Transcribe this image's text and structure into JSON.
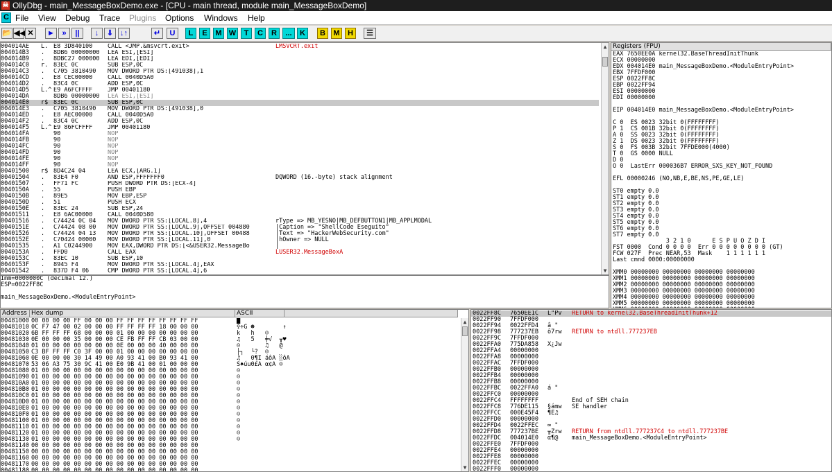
{
  "window": {
    "title": "OllyDbg - main_MessageBoxDemo.exe - [CPU - main thread, module main_MessageBoxDemo]",
    "icon": "ollydbg-app-icon"
  },
  "menu": {
    "c_icon": "C",
    "items": [
      {
        "label": "File",
        "disabled": false
      },
      {
        "label": "View",
        "disabled": false
      },
      {
        "label": "Debug",
        "disabled": false
      },
      {
        "label": "Trace",
        "disabled": false
      },
      {
        "label": "Plugins",
        "disabled": true
      },
      {
        "label": "Options",
        "disabled": false
      },
      {
        "label": "Windows",
        "disabled": false
      },
      {
        "label": "Help",
        "disabled": false
      }
    ]
  },
  "toolbar": {
    "ctrl_buttons": [
      "►",
      "»",
      "||",
      "↓",
      "⇓",
      "↓↑",
      "↵",
      "U"
    ],
    "letter_buttons": [
      "L",
      "E",
      "M",
      "W",
      "T",
      "C",
      "R",
      "...",
      "K"
    ],
    "yellow_buttons": [
      "B",
      "M",
      "H"
    ]
  },
  "disasm": {
    "rows": [
      [
        "004014AE",
        "L.",
        "E8 3D840100",
        "CALL <JMP.&msvcrt.exit>",
        "LMSVCRT.exit",
        "red"
      ],
      [
        "004014B3",
        ".",
        "8DB6 00000000",
        "LEA ESI,[ESI]",
        "",
        ""
      ],
      [
        "004014B9",
        ".",
        "8DBC27 000000",
        "LEA EDI,[EDI]",
        "",
        ""
      ],
      [
        "004014C0",
        "r.",
        "83EC 0C",
        "SUB ESP,0C",
        "",
        ""
      ],
      [
        "004014C3",
        ".",
        "C705 3810490",
        "MOV DWORD PTR DS:[491038],1",
        "",
        ""
      ],
      [
        "004014CD",
        ".",
        "E8 CEC00000",
        "CALL 0040D5A0",
        "",
        ""
      ],
      [
        "004014D2",
        ".",
        "83C4 0C",
        "ADD ESP,0C",
        "",
        ""
      ],
      [
        "004014D5",
        "L.^",
        "E9 A6FCFFFF",
        "JMP 00401180",
        "",
        ""
      ],
      [
        "004014DA",
        "",
        "8DB6 00000000",
        "LEA ESI,[ESI]",
        "",
        "gray"
      ],
      [
        "004014E0",
        "r$",
        "83EC 0C",
        "SUB ESP,0C",
        "",
        "sel"
      ],
      [
        "004014E3",
        ".",
        "C705 3810490",
        "MOV DWORD PTR DS:[491038],0",
        "",
        ""
      ],
      [
        "004014ED",
        ".",
        "E8 AEC00000",
        "CALL 0040D5A0",
        "",
        ""
      ],
      [
        "004014F2",
        ".",
        "83C4 0C",
        "ADD ESP,0C",
        "",
        ""
      ],
      [
        "004014F5",
        "L.^",
        "E9 86FCFFFF",
        "JMP 00401180",
        "",
        ""
      ],
      [
        "004014FA",
        "",
        "90",
        "NOP",
        "",
        "gray"
      ],
      [
        "004014FB",
        "",
        "90",
        "NOP",
        "",
        "gray"
      ],
      [
        "004014FC",
        "",
        "90",
        "NOP",
        "",
        "gray"
      ],
      [
        "004014FD",
        "",
        "90",
        "NOP",
        "",
        "gray"
      ],
      [
        "004014FE",
        "",
        "90",
        "NOP",
        "",
        "gray"
      ],
      [
        "004014FF",
        "",
        "90",
        "NOP",
        "",
        "gray"
      ],
      [
        "00401500",
        "r$",
        "8D4C24 04",
        "LEA ECX,[ARG.1]",
        "",
        ""
      ],
      [
        "00401504",
        ".",
        "83E4 F0",
        "AND ESP,FFFFFFF0",
        "DQWORD (16.-byte) stack alignment",
        ""
      ],
      [
        "00401507",
        ".",
        "FF71 FC",
        "PUSH DWORD PTR DS:[ECX-4]",
        "",
        ""
      ],
      [
        "0040150A",
        ".",
        "55",
        "PUSH EBP",
        "",
        ""
      ],
      [
        "0040150B",
        ".",
        "89E5",
        "MOV EBP,ESP",
        "",
        ""
      ],
      [
        "0040150D",
        ".",
        "51",
        "PUSH ECX",
        "",
        ""
      ],
      [
        "0040150E",
        ".",
        "83EC 24",
        "SUB ESP,24",
        "",
        ""
      ],
      [
        "00401511",
        ".",
        "E8 6AC00000",
        "CALL 0040D580",
        "",
        ""
      ],
      [
        "00401516",
        ".",
        "C74424 0C 04",
        "MOV DWORD PTR SS:[LOCAL.8],4",
        "rType => MB_YESNO|MB_DEFBUTTON1|MB_APPLMODAL",
        ""
      ],
      [
        "0040151E",
        ".",
        "C74424 08 00",
        "MOV DWORD PTR SS:[LOCAL.9],OFFSET 004880",
        "|Caption => \"ShellCode Eseguito\"",
        ""
      ],
      [
        "00401526",
        ".",
        "C74424 04 13",
        "MOV DWORD PTR SS:[LOCAL.10],OFFSET 00488",
        "|Text => \"HackerWebSecurity.com\"",
        ""
      ],
      [
        "0040152E",
        ".",
        "C70424 00000",
        "MOV DWORD PTR SS:[LOCAL.11],0",
        "|hOwner => NULL",
        ""
      ],
      [
        "00401535",
        ".",
        "A1 C0244900",
        "MOV EAX,DWORD PTR DS:[<&USER32.MessageBo",
        "|",
        ""
      ],
      [
        "0040153A",
        ".",
        "FFD0",
        "CALL EAX",
        "LUSER32.MessageBoxA",
        "red"
      ],
      [
        "0040153C",
        ".",
        "83EC 10",
        "SUB ESP,10",
        "",
        ""
      ],
      [
        "0040153F",
        ".",
        "8945 F4",
        "MOV DWORD PTR SS:[LOCAL.4],EAX",
        "",
        ""
      ],
      [
        "00401542",
        ".",
        "837D F4 06",
        "CMP DWORD PTR SS:[LOCAL.4],6",
        "",
        ""
      ]
    ]
  },
  "info": {
    "lines": [
      "Imm=0000000C (decimal 12.)",
      "ESP=0022FF8C",
      "",
      "main_MessageBoxDemo.<ModuleEntryPoint>"
    ]
  },
  "registers": {
    "header": "Registers (FPU)",
    "lines": [
      [
        "EAX 7650EE0A kernel32.BaseThreadInitThunk",
        ""
      ],
      [
        "ECX 00000000",
        ""
      ],
      [
        "EDX 004014E0 main_MessageBoxDemo.<ModuleEntryPoint>",
        ""
      ],
      [
        "EBX 7FFDF000",
        ""
      ],
      [
        "ESP 0022FF8C",
        ""
      ],
      [
        "EBP 0022FF94",
        ""
      ],
      [
        "ESI 00000000",
        ""
      ],
      [
        "EDI 00000000",
        ""
      ],
      [
        "",
        ""
      ],
      [
        "EIP 004014E0 main_MessageBoxDemo.<ModuleEntryPoint>",
        ""
      ],
      [
        "",
        ""
      ],
      [
        "C 0  ES 0023 32bit 0(FFFFFFFF)",
        ""
      ],
      [
        "P 1  CS 001B 32bit 0(FFFFFFFF)",
        ""
      ],
      [
        "A 0  SS 0023 32bit 0(FFFFFFFF)",
        ""
      ],
      [
        "Z 1  DS 0023 32bit 0(FFFFFFFF)",
        ""
      ],
      [
        "S 0  FS 003B 32bit 7FFDE000(4000)",
        ""
      ],
      [
        "T 0  GS 0000 NULL",
        ""
      ],
      [
        "D 0",
        ""
      ],
      [
        "O 0  LastErr 000036B7 ERROR_SXS_KEY_NOT_FOUND",
        ""
      ],
      [
        "",
        ""
      ],
      [
        "EFL 00000246 (NO,NB,E,BE,NS,PE,GE,LE)",
        ""
      ],
      [
        "",
        ""
      ],
      [
        "ST0 empty 0.0",
        ""
      ],
      [
        "ST1 empty 0.0",
        ""
      ],
      [
        "ST2 empty 0.0",
        ""
      ],
      [
        "ST3 empty 0.0",
        ""
      ],
      [
        "ST4 empty 0.0",
        ""
      ],
      [
        "ST5 empty 0.0",
        ""
      ],
      [
        "ST6 empty 0.0",
        ""
      ],
      [
        "ST7 empty 0.0",
        ""
      ],
      [
        "               3 2 1 0      E S P U O Z D I",
        ""
      ],
      [
        "FST 0000  Cond 0 0 0 0  Err 0 0 0 0 0 0 0 0 (GT)",
        ""
      ],
      [
        "FCW 027F  Prec NEAR,53  Mask    1 1 1 1 1 1",
        ""
      ],
      [
        "Last cmnd 0000:00000000",
        ""
      ],
      [
        "",
        ""
      ],
      [
        "XMM0 00000000 00000000 00000000 00000000",
        ""
      ],
      [
        "XMM1 00000000 00000000 00000000 00000000",
        ""
      ],
      [
        "XMM2 00000000 00000000 00000000 00000000",
        ""
      ],
      [
        "XMM3 00000000 00000000 00000000 00000000",
        ""
      ],
      [
        "XMM4 00000000 00000000 00000000 00000000",
        ""
      ],
      [
        "XMM5 00000000 00000000 00000000 00000000",
        ""
      ],
      [
        "XMM6 00000000 00000000 00000000 00000000",
        ""
      ],
      [
        "XMM7 00000000 00000000 00000000 00000000",
        ""
      ]
    ]
  },
  "dump": {
    "headers": [
      "Address",
      "Hex dump",
      "ASCII"
    ],
    "rows": [
      [
        "00481000",
        "00 00 00 00 FF 00 00 00 FF FF FF FF FF FF FF FF",
        "█          "
      ],
      [
        "00481010",
        "0C F7 47 00 02 00 00 00 FF FF FF FF 18 00 00 00",
        "♀÷G ☻        ↑"
      ],
      [
        "00481020",
        "6B FF FF FF 68 00 00 00 01 00 00 00 00 00 00 00",
        "k   h   ☺   "
      ],
      [
        "00481030",
        "0E 00 00 00 35 00 00 00 CE FB FF FF CB 03 00 00",
        "♫   5   ╪√  ╥♥"
      ],
      [
        "00481040",
        "01 00 00 00 00 00 00 00 0E 00 00 00 40 00 00 00",
        "☺       ♫   @"
      ],
      [
        "00481050",
        "C3 BF FF FF C0 3F 00 00 01 00 00 00 00 00 00 00",
        "├┐  └?  ☺   "
      ],
      [
        "00481060",
        "0E 00 00 00 30 14 49 00 A0 93 41 00 B0 93 41 00",
        "♫   0¶I áôA ░ôA"
      ],
      [
        "00481070",
        "53 06 A3 75 30 9C 41 00 E0 9B 41 00 01 00 00 00",
        "S♠úu0£A α¢A ☺"
      ],
      [
        "00481080",
        "01 00 00 00 00 00 00 00 00 00 00 00 00 00 00 00",
        "☺"
      ],
      [
        "00481090",
        "01 00 00 00 00 00 00 00 00 00 00 00 00 00 00 00",
        "☺"
      ],
      [
        "004810A0",
        "01 00 00 00 00 00 00 00 00 00 00 00 00 00 00 00",
        "☺"
      ],
      [
        "004810B0",
        "01 00 00 00 00 00 00 00 00 00 00 00 00 00 00 00",
        "☺"
      ],
      [
        "004810C0",
        "01 00 00 00 00 00 00 00 00 00 00 00 00 00 00 00",
        "☺"
      ],
      [
        "004810D0",
        "01 00 00 00 00 00 00 00 00 00 00 00 00 00 00 00",
        "☺"
      ],
      [
        "004810E0",
        "01 00 00 00 00 00 00 00 00 00 00 00 00 00 00 00",
        "☺"
      ],
      [
        "004810F0",
        "01 00 00 00 00 00 00 00 00 00 00 00 00 00 00 00",
        "☺"
      ],
      [
        "00481100",
        "01 00 00 00 00 00 00 00 00 00 00 00 00 00 00 00",
        "☺"
      ],
      [
        "00481110",
        "01 00 00 00 00 00 00 00 00 00 00 00 00 00 00 00",
        "☺"
      ],
      [
        "00481120",
        "01 00 00 00 00 00 00 00 00 00 00 00 00 00 00 00",
        "☺"
      ],
      [
        "00481130",
        "01 00 00 00 00 00 00 00 00 00 00 00 00 00 00 00",
        "☺"
      ],
      [
        "00481140",
        "00 00 00 00 00 00 00 00 00 00 00 00 00 00 00 00",
        ""
      ],
      [
        "00481150",
        "00 00 00 00 00 00 00 00 00 00 00 00 00 00 00 00",
        ""
      ],
      [
        "00481160",
        "00 00 00 00 00 00 00 00 00 00 00 00 00 00 00 00",
        ""
      ],
      [
        "00481170",
        "00 00 00 00 00 00 00 00 00 00 00 00 00 00 00 00",
        ""
      ],
      [
        "00481180",
        "00 00 00 00 00 00 00 00 00 00 00 00 00 00 00 00",
        ""
      ]
    ]
  },
  "stack": {
    "rows": [
      [
        "0022FF8C",
        "7650EE1C",
        "L\"Pv",
        "RETURN to kernel32.BaseThreadInitThunk+12",
        "red"
      ],
      [
        "0022FF90",
        "7FFDF000",
        "",
        "",
        ""
      ],
      [
        "0022FF94",
        "0022FFD4",
        "â \"",
        "",
        ""
      ],
      [
        "0022FF98",
        "777237EB",
        "ô7rw",
        "RETURN to ntdll.777237EB",
        "red"
      ],
      [
        "0022FF9C",
        "7FFDF000",
        "",
        "",
        ""
      ],
      [
        "0022FFA0",
        "775DA858",
        "X¿Jw",
        "",
        ""
      ],
      [
        "0022FFA4",
        "00000000",
        "",
        "",
        ""
      ],
      [
        "0022FFA8",
        "00000000",
        "",
        "",
        ""
      ],
      [
        "0022FFAC",
        "7FFDF000",
        "",
        "",
        ""
      ],
      [
        "0022FFB0",
        "00000000",
        "",
        "",
        ""
      ],
      [
        "0022FFB4",
        "00000000",
        "",
        "",
        ""
      ],
      [
        "0022FFB8",
        "00000000",
        "",
        "",
        ""
      ],
      [
        "0022FFBC",
        "0022FFA0",
        "á \"",
        "",
        ""
      ],
      [
        "0022FFC0",
        "00000000",
        "",
        "",
        ""
      ],
      [
        "0022FFC4",
        "FFFFFFFF",
        "",
        "End of SEH chain",
        ""
      ],
      [
        "0022FFC8",
        "776DE115",
        "§ámw",
        "SE handler",
        ""
      ],
      [
        "0022FFCC",
        "000E45F4",
        "¶E♫",
        "",
        ""
      ],
      [
        "0022FFD0",
        "00000000",
        "",
        "",
        ""
      ],
      [
        "0022FFD4",
        "0022FFEC",
        "∞ \"",
        "",
        ""
      ],
      [
        "0022FFD8",
        "777237BE",
        "╥Zrw",
        "RETURN from ntdll.777237C4 to ntdll.777237BE",
        "red"
      ],
      [
        "0022FFDC",
        "004014E0",
        "α¶@",
        "main_MessageBoxDemo.<ModuleEntryPoint>",
        ""
      ],
      [
        "0022FFE0",
        "7FFDF000",
        "",
        "",
        ""
      ],
      [
        "0022FFE4",
        "00000000",
        "",
        "",
        ""
      ],
      [
        "0022FFE8",
        "00000000",
        "",
        "",
        ""
      ],
      [
        "0022FFEC",
        "00000000",
        "",
        "",
        ""
      ],
      [
        "0022FFF0",
        "00000000",
        "",
        "",
        ""
      ],
      [
        "0022FFF4",
        "00000000",
        "",
        "",
        ""
      ],
      [
        "0022FFF8",
        "004014E0",
        "",
        "",
        ""
      ],
      [
        "0022FFFC",
        "7FFDF000",
        "",
        "",
        ""
      ]
    ]
  }
}
